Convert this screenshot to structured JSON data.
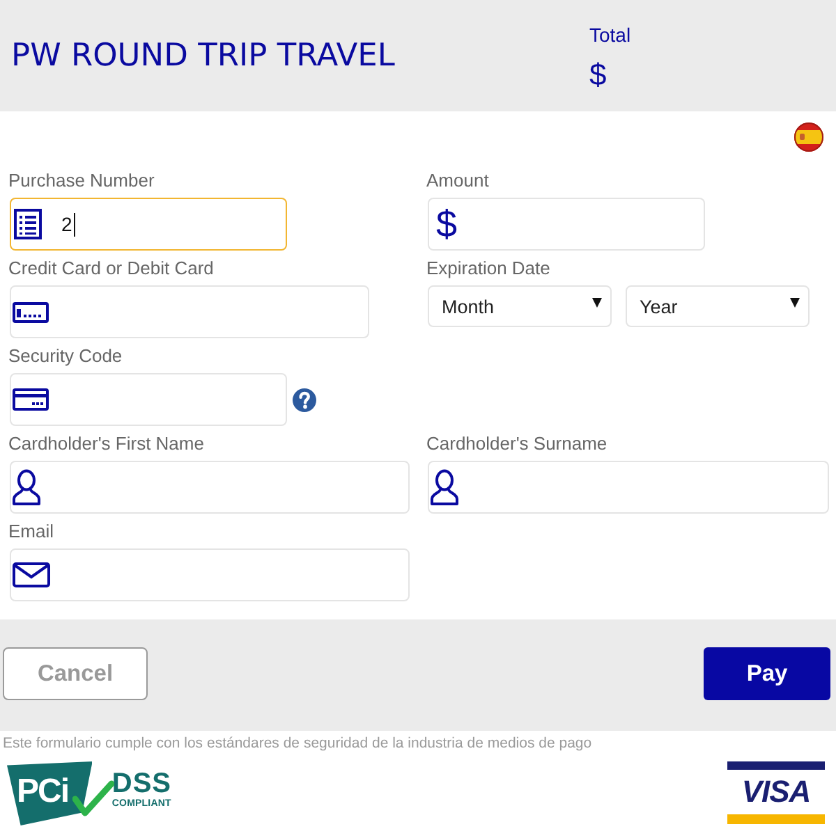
{
  "header": {
    "title": "PW ROUND TRIP TRAVEL",
    "total": {
      "label": "Total",
      "value": "$"
    }
  },
  "form": {
    "purchase_number": {
      "label": "Purchase Number",
      "value": "2",
      "focused": true
    },
    "amount": {
      "label": "Amount",
      "prefix": "$",
      "focused": false
    },
    "card_number": {
      "label": "Credit Card or Debit Card",
      "focused": false
    },
    "expiration": {
      "label": "Expiration Date",
      "month": {
        "value": "Month",
        "focused": false
      },
      "year": {
        "value": "Year",
        "focused": false
      }
    },
    "security_code": {
      "label": "Security Code",
      "focused": false
    },
    "first_name": {
      "label": "Cardholder's First Name",
      "focused": false
    },
    "surname": {
      "label": "Cardholder's Surname",
      "focused": false
    },
    "email": {
      "label": "Email",
      "focused": false
    }
  },
  "actions": {
    "cancel": "Cancel",
    "pay": "Pay"
  },
  "footer": {
    "notice": "Este formulario cumple con los estándares de seguridad de la industria de medios de pago",
    "pci_logo": {
      "mark": "PCi",
      "name": "DSS",
      "caption": "COMPLIANT"
    },
    "visa_logo": "VISA"
  }
}
